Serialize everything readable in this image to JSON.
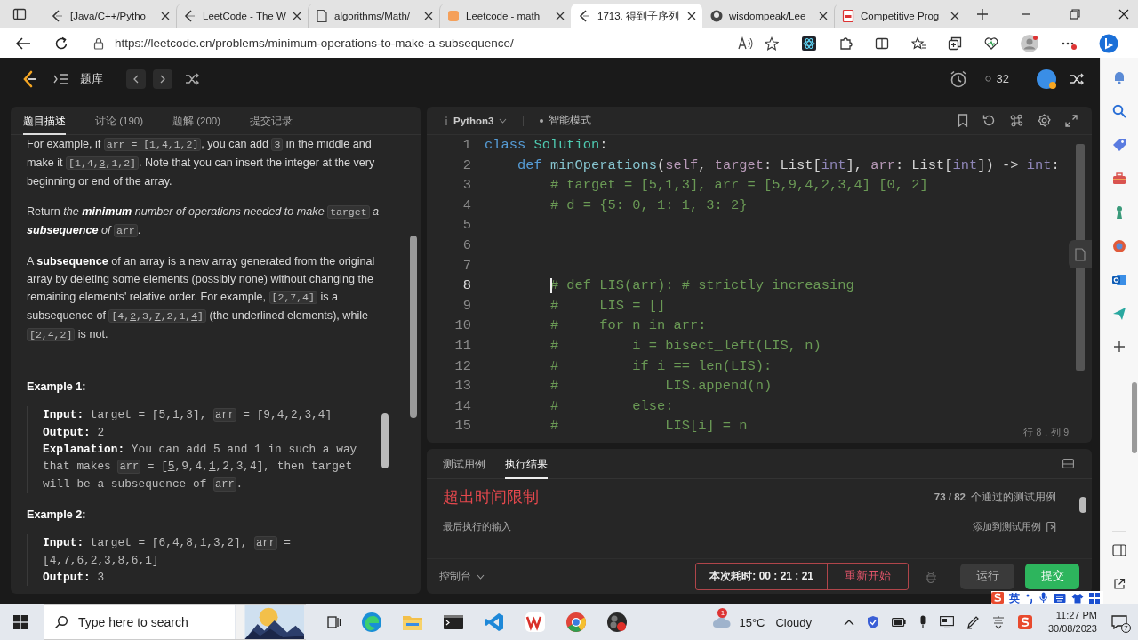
{
  "browser": {
    "tabs": [
      {
        "title": "[Java/C++/Pytho",
        "selected": false
      },
      {
        "title": "LeetCode - The W",
        "selected": false
      },
      {
        "title": "algorithms/Math/",
        "selected": false
      },
      {
        "title": "Leetcode - math",
        "selected": false
      },
      {
        "title": "1713. 得到子序列",
        "selected": true
      },
      {
        "title": "wisdompeak/Lee",
        "selected": false
      },
      {
        "title": "Competitive Prog",
        "selected": false
      }
    ],
    "url": "https://leetcode.cn/problems/minimum-operations-to-make-a-subsequence/"
  },
  "header": {
    "nav_label": "题库",
    "count": "32"
  },
  "problem_panel": {
    "tabs": [
      {
        "label": "题目描述",
        "selected": true
      },
      {
        "label": "讨论 (190)",
        "selected": false
      },
      {
        "label": "题解 (200)",
        "selected": false
      },
      {
        "label": "提交记录",
        "selected": false
      }
    ],
    "paragraphs": [
      [
        {
          "kind": "text",
          "text": "For example, if "
        },
        {
          "kind": "code",
          "text": "arr = [1,4,1,2]"
        },
        {
          "kind": "text",
          "text": ", you can add "
        },
        {
          "kind": "code",
          "text": "3"
        },
        {
          "kind": "text",
          "text": " in the middle and make it "
        },
        {
          "kind": "code",
          "pieces": [
            {
              "text": "[1,4,"
            },
            {
              "text": "3",
              "underline": true
            },
            {
              "text": ",1,2]"
            }
          ]
        },
        {
          "kind": "text",
          "text": ". Note that you can insert the integer at the very beginning or end of the array."
        }
      ],
      [
        {
          "kind": "text",
          "text": "Return "
        },
        {
          "kind": "em",
          "text": "the "
        },
        {
          "kind": "boldem",
          "text": "minimum"
        },
        {
          "kind": "em",
          "text": " number of operations needed to make "
        },
        {
          "kind": "code",
          "text": "target"
        },
        {
          "kind": "em",
          "text": " a "
        },
        {
          "kind": "boldem",
          "text": "subsequence"
        },
        {
          "kind": "em",
          "text": " of "
        },
        {
          "kind": "code",
          "text": "arr"
        },
        {
          "kind": "text",
          "text": "."
        }
      ],
      [
        {
          "kind": "text",
          "text": "A "
        },
        {
          "kind": "bold",
          "text": "subsequence"
        },
        {
          "kind": "text",
          "text": " of an array is a new array generated from the original array by deleting some elements (possibly none) without changing the remaining elements' relative order. For example, "
        },
        {
          "kind": "code",
          "text": "[2,7,4]"
        },
        {
          "kind": "text",
          "text": " is a subsequence of "
        },
        {
          "kind": "code",
          "pieces": [
            {
              "text": "[4,"
            },
            {
              "text": "2",
              "underline": true
            },
            {
              "text": ",3,"
            },
            {
              "text": "7",
              "underline": true
            },
            {
              "text": ",2,1,"
            },
            {
              "text": "4",
              "underline": true
            },
            {
              "text": "]"
            }
          ]
        },
        {
          "kind": "text",
          "text": " (the underlined elements), while "
        },
        {
          "kind": "code",
          "text": "[2,4,2]"
        },
        {
          "kind": "text",
          "text": " is not."
        }
      ]
    ],
    "examples": [
      {
        "heading": "Example 1:",
        "lines": [
          [
            {
              "kind": "bold",
              "text": "Input:"
            },
            {
              "kind": "text",
              "text": " target = [5,1,3], "
            },
            {
              "kind": "code",
              "text": "arr"
            },
            {
              "kind": "text",
              "text": " = [9,4,2,3,4]"
            }
          ],
          [
            {
              "kind": "bold",
              "text": "Output:"
            },
            {
              "kind": "text",
              "text": " 2"
            }
          ],
          [
            {
              "kind": "bold",
              "text": "Explanation:"
            },
            {
              "kind": "text",
              "text": " You can add 5 and 1 in such a way that makes "
            },
            {
              "kind": "code",
              "text": "arr"
            },
            {
              "kind": "text",
              "text": " = ["
            },
            {
              "kind": "code_plain",
              "pieces": [
                {
                  "text": "5",
                  "underline": true
                },
                {
                  "text": ",9,4,"
                },
                {
                  "text": "1",
                  "underline": true
                }
              ]
            },
            {
              "kind": "text",
              "text": ",2,3,4], then target will be a subsequence of "
            },
            {
              "kind": "code",
              "text": "arr"
            },
            {
              "kind": "text",
              "text": "."
            }
          ]
        ]
      },
      {
        "heading": "Example 2:",
        "lines": [
          [
            {
              "kind": "bold",
              "text": "Input:"
            },
            {
              "kind": "text",
              "text": " target = [6,4,8,1,3,2], "
            },
            {
              "kind": "code",
              "text": "arr"
            },
            {
              "kind": "text",
              "text": " = [4,7,6,2,3,8,6,1]"
            }
          ],
          [
            {
              "kind": "bold",
              "text": "Output:"
            },
            {
              "kind": "text",
              "text": " 3"
            }
          ]
        ]
      }
    ]
  },
  "editor": {
    "language": "Python3",
    "mode": "智能模式",
    "cursor_position": "行 8，列 9",
    "lines": [
      {
        "number": "1",
        "current": false,
        "tokens": [
          {
            "kind": "keyword",
            "text": "class"
          },
          {
            "kind": "class",
            "text": " Solution"
          },
          {
            "kind": "plain",
            "text": ":"
          }
        ]
      },
      {
        "number": "2",
        "current": false,
        "tokens": [
          {
            "kind": "keyword",
            "text": "    def"
          },
          {
            "kind": "function",
            "text": " minOperations"
          },
          {
            "kind": "plain",
            "text": "("
          },
          {
            "kind": "param",
            "text": "self"
          },
          {
            "kind": "plain",
            "text": ", "
          },
          {
            "kind": "param",
            "text": "target"
          },
          {
            "kind": "plain",
            "text": ": List["
          },
          {
            "kind": "type",
            "text": "int"
          },
          {
            "kind": "plain",
            "text": "], "
          },
          {
            "kind": "param",
            "text": "arr"
          },
          {
            "kind": "plain",
            "text": ": List["
          },
          {
            "kind": "type",
            "text": "int"
          },
          {
            "kind": "plain",
            "text": "]) -> "
          },
          {
            "kind": "type",
            "text": "int"
          },
          {
            "kind": "plain",
            "text": ":"
          }
        ]
      },
      {
        "number": "3",
        "current": false,
        "tokens": [
          {
            "kind": "comment",
            "text": "        # target = [5,1,3], arr = [5,9,4,2,3,4] [0, 2]"
          }
        ]
      },
      {
        "number": "4",
        "current": false,
        "tokens": [
          {
            "kind": "comment",
            "text": "        # d = {5: 0, 1: 1, 3: 2}"
          }
        ]
      },
      {
        "number": "5",
        "current": false
      },
      {
        "number": "6",
        "current": false
      },
      {
        "number": "7",
        "current": false
      },
      {
        "number": "8",
        "current": true,
        "tokens": [
          {
            "kind": "comment",
            "text": "        # def LIS(arr): # strictly increasing"
          }
        ]
      },
      {
        "number": "9",
        "current": false,
        "tokens": [
          {
            "kind": "comment",
            "text": "        #     LIS = []"
          }
        ]
      },
      {
        "number": "10",
        "current": false,
        "tokens": [
          {
            "kind": "comment",
            "text": "        #     for n in arr:"
          }
        ]
      },
      {
        "number": "11",
        "current": false,
        "tokens": [
          {
            "kind": "comment",
            "text": "        #         i = bisect_left(LIS, n)"
          }
        ]
      },
      {
        "number": "12",
        "current": false,
        "tokens": [
          {
            "kind": "comment",
            "text": "        #         if i == len(LIS):"
          }
        ]
      },
      {
        "number": "13",
        "current": false,
        "tokens": [
          {
            "kind": "comment",
            "text": "        #             LIS.append(n)"
          }
        ]
      },
      {
        "number": "14",
        "current": false,
        "tokens": [
          {
            "kind": "comment",
            "text": "        #         else:"
          }
        ]
      },
      {
        "number": "15",
        "current": false,
        "tokens": [
          {
            "kind": "comment",
            "text": "        #             LIS[i] = n"
          }
        ]
      }
    ]
  },
  "result_panel": {
    "tabs": [
      {
        "label": "测试用例",
        "selected": false
      },
      {
        "label": "执行结果",
        "selected": true
      }
    ],
    "verdict": "超出时间限制",
    "passed": "73 / 82",
    "passed_label": "个通过的测试用例",
    "last_input_label": "最后执行的输入",
    "add_test_label": "添加到测试用例",
    "console_label": "控制台",
    "timer": "本次耗时: 00 : 21 : 21",
    "restart_label": "重新开始",
    "run_label": "运行",
    "submit_label": "提交"
  },
  "ime": {
    "mode": "英"
  },
  "taskbar": {
    "search_placeholder": "Type here to search",
    "temperature": "15°C",
    "condition": "Cloudy",
    "weather_badge": "1",
    "time": "11:27 PM",
    "date": "30/08/2023",
    "notifications": "7"
  }
}
